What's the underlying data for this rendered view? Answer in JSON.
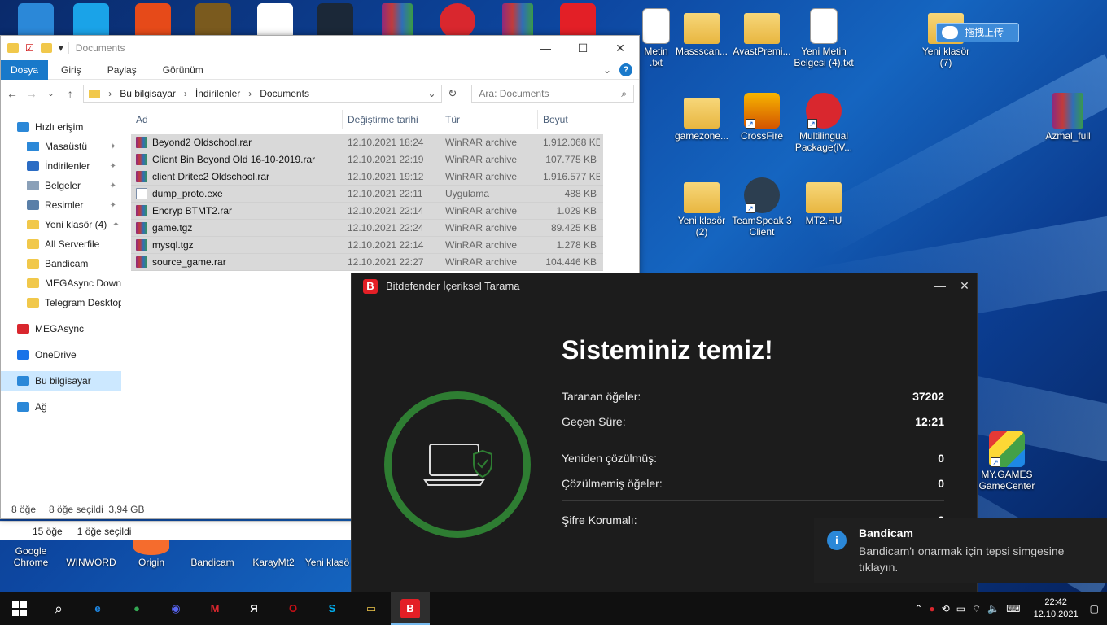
{
  "desktop": {
    "icons": [
      {
        "label": "Metin\n.txt",
        "kind": "doc"
      },
      {
        "label": "Massscan...",
        "kind": "folder"
      },
      {
        "label": "AvastPremi...",
        "kind": "folder"
      },
      {
        "label": "Yeni Metin\nBelgesi (4).txt",
        "kind": "doc"
      },
      {
        "label": "Yeni klasör\n(7)",
        "kind": "folder"
      },
      {
        "label": "Azmal_full",
        "kind": "rar"
      },
      {
        "label": "gamezone...",
        "kind": "folder"
      },
      {
        "label": "CrossFire",
        "kind": "app"
      },
      {
        "label": "Multilingual\nPackage(iV...",
        "kind": "app"
      },
      {
        "label": "Yeni klasör\n(2)",
        "kind": "folder"
      },
      {
        "label": "TeamSpeak 3\nClient",
        "kind": "app"
      },
      {
        "label": "MT2.HU",
        "kind": "folder"
      },
      {
        "label": "MY.GAMES\nGameCenter",
        "kind": "app"
      },
      {
        "label": "Google\nChrome",
        "kind": "app"
      },
      {
        "label": "WINWORD",
        "kind": "app"
      },
      {
        "label": "Origin",
        "kind": "app"
      },
      {
        "label": "Bandicam",
        "kind": "app"
      },
      {
        "label": "KarayMt2",
        "kind": "app"
      },
      {
        "label": "Yeni klasö",
        "kind": "folder"
      }
    ],
    "upload_badge": "拖拽上传"
  },
  "explorer": {
    "title": "Documents",
    "ribbon_tabs": [
      "Dosya",
      "Giriş",
      "Paylaş",
      "Görünüm"
    ],
    "breadcrumb": [
      "Bu bilgisayar",
      "İndirilenler",
      "Documents"
    ],
    "search_placeholder": "Ara: Documents",
    "nav": [
      {
        "label": "Hızlı erişim",
        "icon": "star-icon",
        "color": "#2b88d8",
        "sub": false,
        "pin": false
      },
      {
        "label": "Masaüstü",
        "icon": "desktop-icon",
        "color": "#2b88d8",
        "sub": true,
        "pin": true
      },
      {
        "label": "İndirilenler",
        "icon": "download-icon",
        "color": "#2b6cc4",
        "sub": true,
        "pin": true
      },
      {
        "label": "Belgeler",
        "icon": "document-icon",
        "color": "#8aa0b8",
        "sub": true,
        "pin": true
      },
      {
        "label": "Resimler",
        "icon": "picture-icon",
        "color": "#5a7fa8",
        "sub": true,
        "pin": true
      },
      {
        "label": "Yeni klasör (4)",
        "icon": "folder-icon",
        "color": "#f1c84b",
        "sub": true,
        "pin": true
      },
      {
        "label": "All Serverfile",
        "icon": "folder-icon",
        "color": "#f1c84b",
        "sub": true,
        "pin": false
      },
      {
        "label": "Bandicam",
        "icon": "folder-icon",
        "color": "#f1c84b",
        "sub": true,
        "pin": false
      },
      {
        "label": "MEGAsync Down",
        "icon": "folder-icon",
        "color": "#f1c84b",
        "sub": true,
        "pin": false
      },
      {
        "label": "Telegram Desktop",
        "icon": "folder-icon",
        "color": "#f1c84b",
        "sub": true,
        "pin": false
      },
      {
        "label": "MEGAsync",
        "icon": "mega-icon",
        "color": "#d9272e",
        "sub": false,
        "pin": false
      },
      {
        "label": "OneDrive",
        "icon": "cloud-icon",
        "color": "#1a73e8",
        "sub": false,
        "pin": false
      },
      {
        "label": "Bu bilgisayar",
        "icon": "computer-icon",
        "color": "#2b88d8",
        "sub": false,
        "pin": false,
        "selected": true
      },
      {
        "label": "Ağ",
        "icon": "network-icon",
        "color": "#2b88d8",
        "sub": false,
        "pin": false
      }
    ],
    "columns": [
      "Ad",
      "Değiştirme tarihi",
      "Tür",
      "Boyut"
    ],
    "files": [
      {
        "name": "Beyond2 Oldschool.rar",
        "date": "12.10.2021 18:24",
        "type": "WinRAR archive",
        "size": "1.912.068 KB",
        "kind": "rar"
      },
      {
        "name": "Client Bin Beyond Old 16-10-2019.rar",
        "date": "12.10.2021 22:19",
        "type": "WinRAR archive",
        "size": "107.775 KB",
        "kind": "rar"
      },
      {
        "name": "client Dritec2 Oldschool.rar",
        "date": "12.10.2021 19:12",
        "type": "WinRAR archive",
        "size": "1.916.577 KB",
        "kind": "rar"
      },
      {
        "name": "dump_proto.exe",
        "date": "12.10.2021 22:11",
        "type": "Uygulama",
        "size": "488 KB",
        "kind": "exe"
      },
      {
        "name": "Encryp BTMT2.rar",
        "date": "12.10.2021 22:14",
        "type": "WinRAR archive",
        "size": "1.029 KB",
        "kind": "rar"
      },
      {
        "name": "game.tgz",
        "date": "12.10.2021 22:24",
        "type": "WinRAR archive",
        "size": "89.425 KB",
        "kind": "rar"
      },
      {
        "name": "mysql.tgz",
        "date": "12.10.2021 22:14",
        "type": "WinRAR archive",
        "size": "1.278 KB",
        "kind": "rar"
      },
      {
        "name": "source_game.rar",
        "date": "12.10.2021 22:27",
        "type": "WinRAR archive",
        "size": "104.446 KB",
        "kind": "rar"
      }
    ],
    "status": {
      "count": "8 öğe",
      "selected": "8 öğe seçildi",
      "size": "3,94 GB"
    },
    "status_back": {
      "count": "15 öğe",
      "selected": "1 öğe seçildi"
    }
  },
  "bitdefender": {
    "title": "Bitdefender İçeriksel Tarama",
    "heading": "Sisteminiz temiz!",
    "rows": [
      {
        "label": "Taranan öğeler:",
        "value": "37202"
      },
      {
        "label": "Geçen Süre:",
        "value": "12:21"
      },
      {
        "label": "Yeniden çözülmüş:",
        "value": "0"
      },
      {
        "label": "Çözülmemiş öğeler:",
        "value": "0"
      },
      {
        "label": "Şifre Korumalı:",
        "value": "0"
      }
    ]
  },
  "toast": {
    "title": "Bandicam",
    "body": "Bandicam'ı onarmak için tepsi simgesine tıklayın."
  },
  "taskbar": {
    "apps": [
      {
        "name": "edge",
        "color": "#1e88e5",
        "glyph": "e"
      },
      {
        "name": "chrome",
        "color": "#34a853",
        "glyph": "●"
      },
      {
        "name": "discord",
        "color": "#5865f2",
        "glyph": "◉"
      },
      {
        "name": "mega",
        "color": "#d9272e",
        "glyph": "M"
      },
      {
        "name": "yandex",
        "color": "#fff",
        "glyph": "Я"
      },
      {
        "name": "opera",
        "color": "#cc0f16",
        "glyph": "O"
      },
      {
        "name": "skype",
        "color": "#00aff0",
        "glyph": "S"
      },
      {
        "name": "file-explorer",
        "color": "#f1c84b",
        "glyph": "▭"
      },
      {
        "name": "bitdefender",
        "color": "#e31f26",
        "glyph": "B"
      }
    ],
    "time": "22:42",
    "date": "12.10.2021"
  }
}
